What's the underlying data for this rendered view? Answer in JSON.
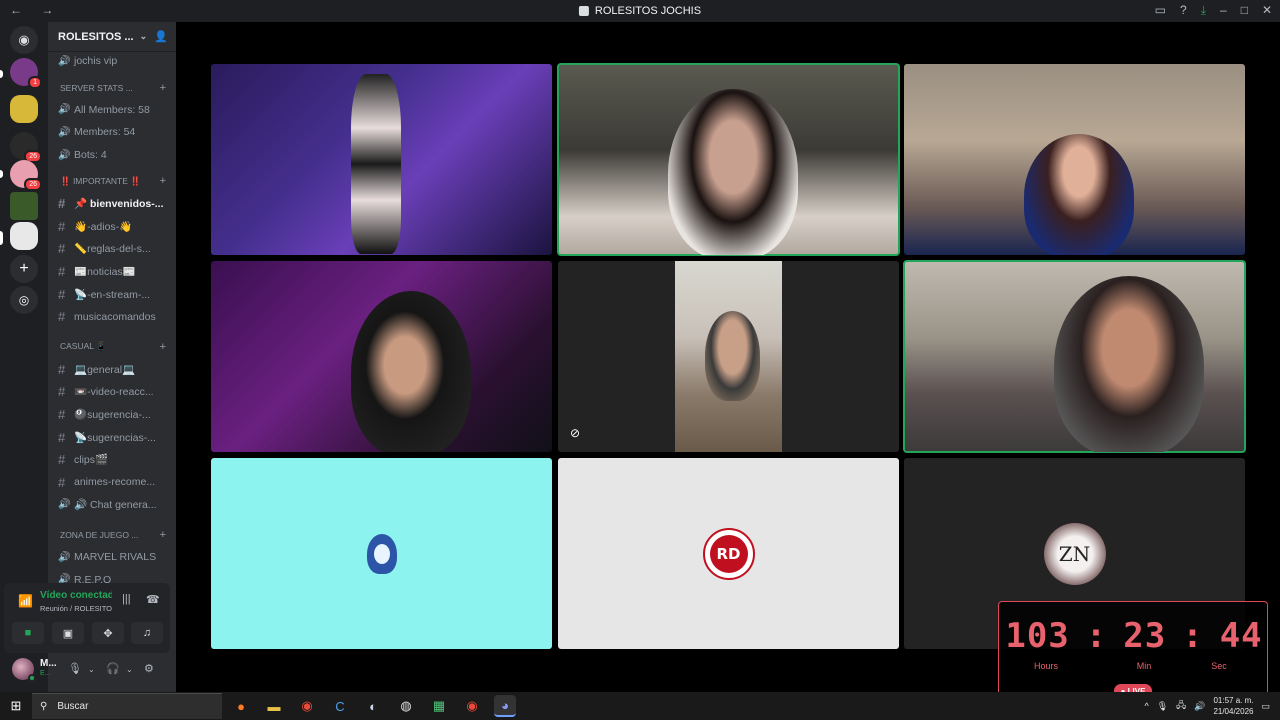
{
  "window": {
    "title": "ROLESITOS JOCHIS"
  },
  "server": {
    "name": "ROLESITOS ..."
  },
  "guilds": [
    {
      "name": "guild-1",
      "badge": "1",
      "color": "#7a3a8a"
    },
    {
      "name": "guild-2",
      "badge": "",
      "color": "#d8b838"
    },
    {
      "name": "guild-3",
      "badge": "26",
      "color": "#2a2a2a"
    },
    {
      "name": "guild-4",
      "badge": "26",
      "color": "#e8a0b0"
    },
    {
      "name": "guild-5",
      "badge": "",
      "color": "#3a5a2a"
    },
    {
      "name": "guild-6",
      "badge": "",
      "color": "#e8e8e8"
    }
  ],
  "channels": {
    "top_item": "jochis vip",
    "cat_stats": "SERVER STATS ...",
    "stats": [
      "All Members: 58",
      "Members: 54",
      "Bots: 4"
    ],
    "cat_important": "‼️ IMPORTANTE ‼️",
    "important": [
      "📌 bienvenidos-...",
      "👋-adios-👋",
      "📏reglas-del-s...",
      "📰noticias📰",
      "📡-en-stream-...",
      "musicacomandos"
    ],
    "cat_casual": "CASUAL 📱",
    "casual": [
      "💻general💻",
      "📼-video-reacc...",
      "🎱sugerencia-...",
      "📡sugerencias-...",
      "clips🎬",
      "animes-recome...",
      "🔊 Chat genera..."
    ],
    "cat_games": "Zona de Juego ...",
    "games": [
      "MARVEL RIVALS",
      "R.E.P.O"
    ]
  },
  "voice": {
    "status": "Vídeo conectado",
    "sub": "Reunión / ROLESITOS JOCHIS"
  },
  "user": {
    "name": "M...",
    "status": "E..."
  },
  "timer": {
    "hours": "103",
    "minutes": "23",
    "seconds": "44",
    "hours_label": "Hours",
    "minutes_label": "Min",
    "seconds_label": "Sec",
    "live_label": "● LIVE",
    "color": "#e8626e"
  },
  "tiles": [
    {
      "id": "vtuber",
      "speaking": false
    },
    {
      "id": "cam-2",
      "speaking": true
    },
    {
      "id": "cam-3",
      "speaking": false
    },
    {
      "id": "cam-4",
      "speaking": false
    },
    {
      "id": "cam-5-phone",
      "speaking": false,
      "muted_video": true
    },
    {
      "id": "cam-6",
      "speaking": true
    },
    {
      "id": "avatar-hood",
      "speaking": false
    },
    {
      "id": "avatar-rd",
      "speaking": false,
      "avatar_text": "RD"
    },
    {
      "id": "avatar-zn",
      "speaking": false,
      "avatar_text": "ZN"
    }
  ],
  "taskbar": {
    "search_label": "Buscar",
    "time": "01:57 a. m.",
    "date": "21/04/2026"
  }
}
